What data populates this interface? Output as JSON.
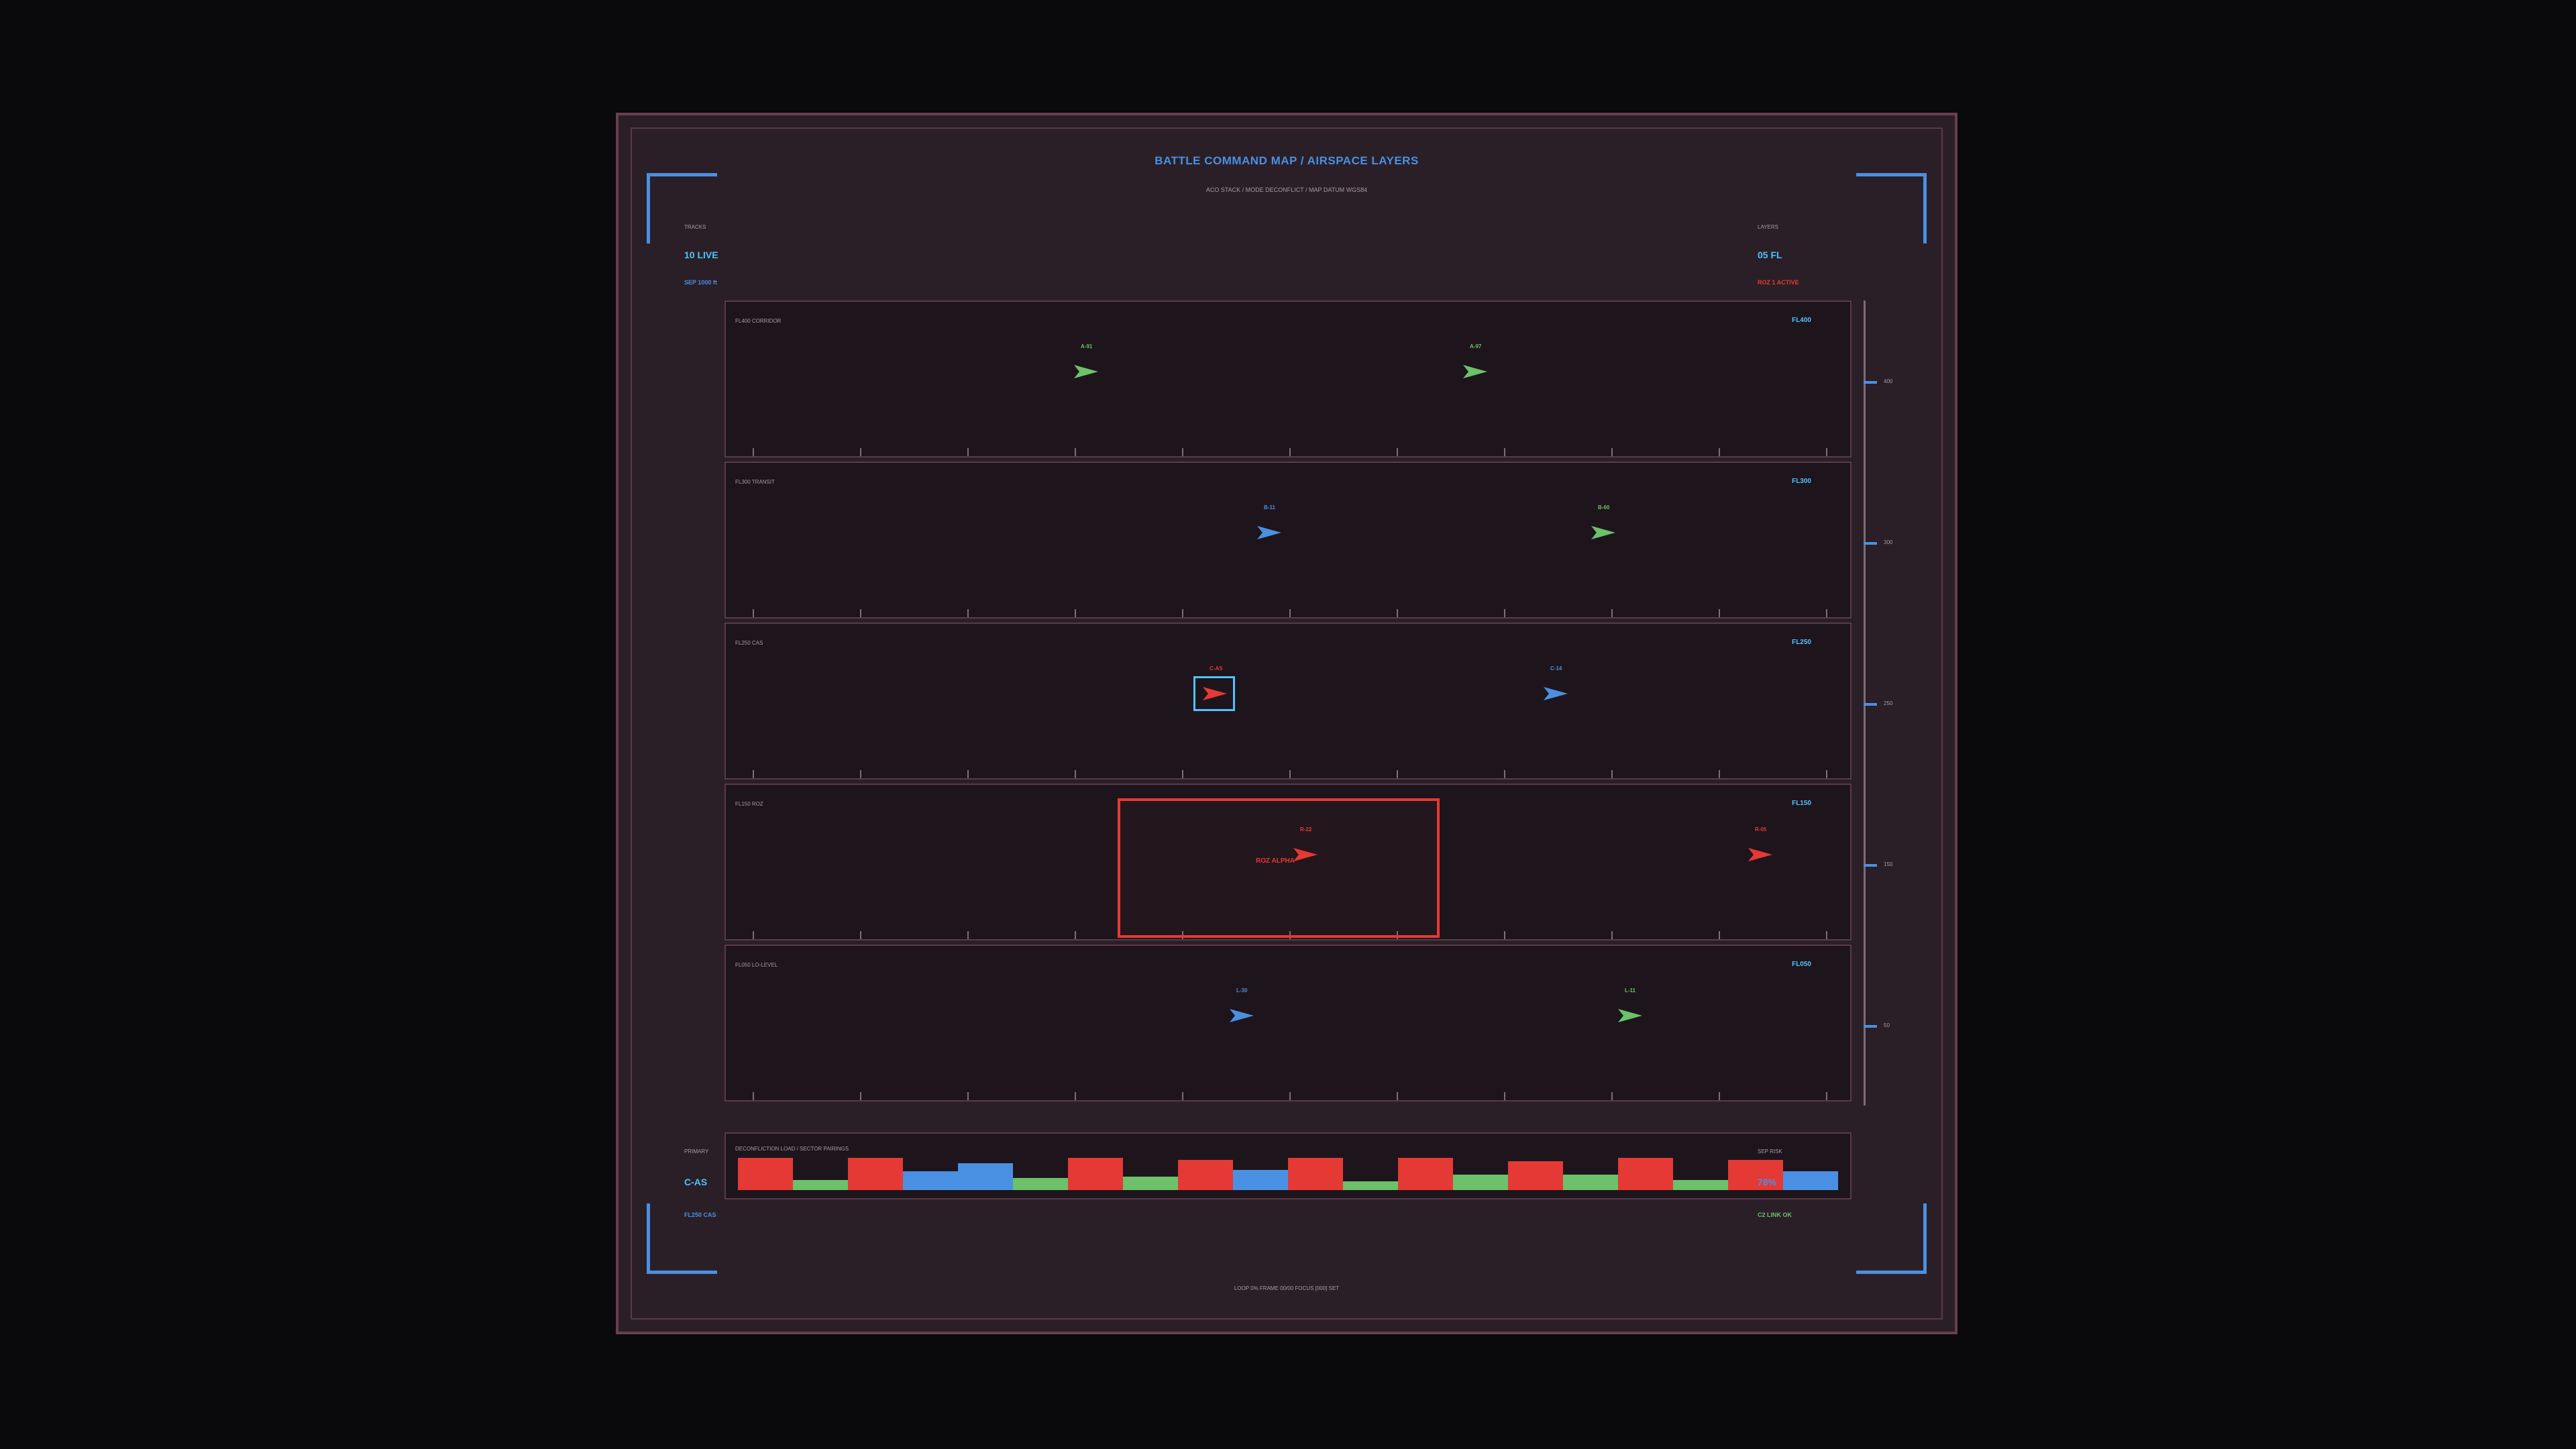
{
  "title": "BATTLE COMMAND MAP  /  AIRSPACE LAYERS",
  "subtitle": "ACO STACK  /  MODE DECONFLICT  /  MAP DATUM WGS84",
  "stats": {
    "tracks": {
      "label": "TRACKS",
      "value": "10 LIVE",
      "sub": "SEP 1000 ft"
    },
    "layers": {
      "label": "LAYERS",
      "value": "05 FL",
      "sub": "ROZ 1 ACTIVE"
    },
    "primary": {
      "label": "PRIMARY",
      "value": "C-AS",
      "sub": "FL250 CAS"
    },
    "sep_risk": {
      "label": "SEP RISK",
      "value": "78%",
      "sub": "C2 LINK OK"
    }
  },
  "colors": {
    "accent": "#4a90e2",
    "cyan": "#4fc3ff",
    "friendly": "#6cc16a",
    "hostile": "#e53935",
    "neutral": "#4a90e2"
  },
  "lanes": [
    {
      "name": "FL400 CORRIDOR",
      "fl": "FL400",
      "tracks": [
        {
          "id": "A-91",
          "color": "#6cc16a"
        },
        {
          "id": "A-97",
          "color": "#6cc16a"
        }
      ]
    },
    {
      "name": "FL300 TRANSIT",
      "fl": "FL300",
      "tracks": [
        {
          "id": "B-11",
          "color": "#4a90e2"
        },
        {
          "id": "B-60",
          "color": "#6cc16a"
        }
      ]
    },
    {
      "name": "FL250 CAS",
      "fl": "FL250",
      "tracks": [
        {
          "id": "C-AS",
          "color": "#e53935",
          "selected": true
        },
        {
          "id": "C-14",
          "color": "#4a90e2"
        }
      ]
    },
    {
      "name": "FL150 ROZ",
      "fl": "FL150",
      "roz_label": "ROZ ALPHA",
      "tracks": [
        {
          "id": "R-22",
          "color": "#e53935"
        },
        {
          "id": "R-05",
          "color": "#e53935"
        }
      ]
    },
    {
      "name": "FL050 LO-LEVEL",
      "fl": "FL050",
      "tracks": [
        {
          "id": "L-30",
          "color": "#4a90e2"
        },
        {
          "id": "L-11",
          "color": "#6cc16a"
        }
      ]
    }
  ],
  "scale_labels": [
    "400",
    "300",
    "250",
    "150",
    "50"
  ],
  "load_panel": {
    "title": "DECONFLICTION LOAD  /  SECTOR PAIRINGS",
    "bars": [
      {
        "value": 0.95,
        "color": "#e53935"
      },
      {
        "value": 0.3,
        "color": "#6cc16a"
      },
      {
        "value": 0.95,
        "color": "#e53935"
      },
      {
        "value": 0.55,
        "color": "#4a90e2"
      },
      {
        "value": 0.8,
        "color": "#4a90e2"
      },
      {
        "value": 0.35,
        "color": "#6cc16a"
      },
      {
        "value": 0.95,
        "color": "#e53935"
      },
      {
        "value": 0.4,
        "color": "#6cc16a"
      },
      {
        "value": 0.9,
        "color": "#e53935"
      },
      {
        "value": 0.6,
        "color": "#4a90e2"
      },
      {
        "value": 0.95,
        "color": "#e53935"
      },
      {
        "value": 0.25,
        "color": "#6cc16a"
      },
      {
        "value": 0.95,
        "color": "#e53935"
      },
      {
        "value": 0.45,
        "color": "#6cc16a"
      },
      {
        "value": 0.85,
        "color": "#e53935"
      },
      {
        "value": 0.45,
        "color": "#6cc16a"
      },
      {
        "value": 0.95,
        "color": "#e53935"
      },
      {
        "value": 0.3,
        "color": "#6cc16a"
      },
      {
        "value": 0.9,
        "color": "#e53935"
      },
      {
        "value": 0.55,
        "color": "#4a90e2"
      }
    ]
  },
  "footer": "LOOP 0% FRAME 00/00 FOCUS [000] SET"
}
